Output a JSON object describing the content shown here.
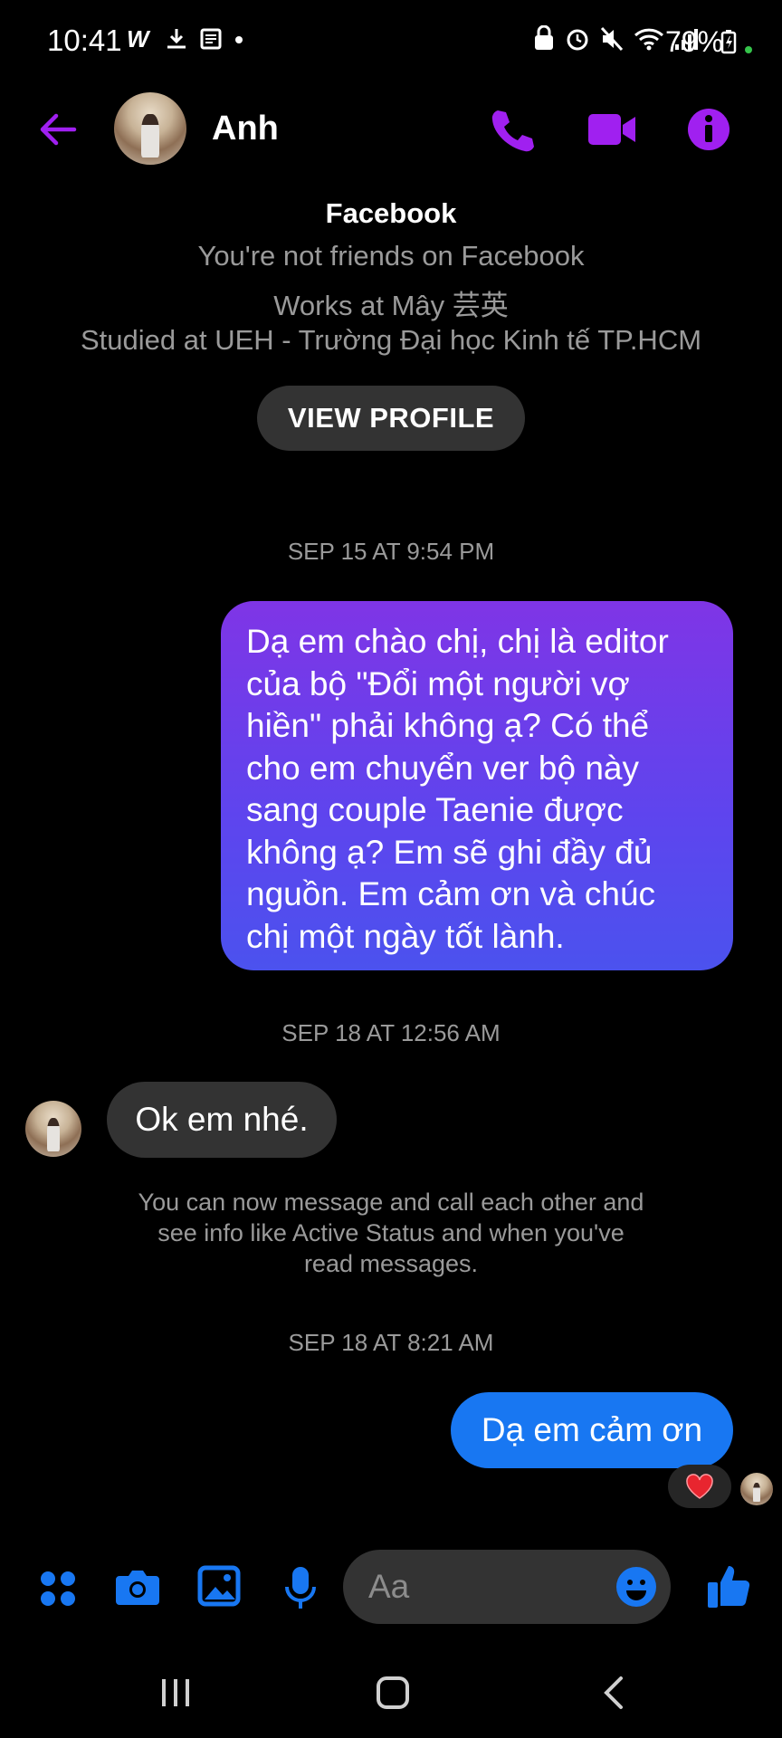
{
  "status_bar": {
    "time": "10:41",
    "battery": "79%"
  },
  "header": {
    "name": "Anh",
    "accent_color": "#a020f0"
  },
  "profile_info": {
    "title": "Facebook",
    "friends_status": "You're not friends on Facebook",
    "work": "Works at Mây 芸英",
    "education": "Studied at UEH - Trường Đại học Kinh tế TP.HCM",
    "view_profile_label": "VIEW PROFILE"
  },
  "messages": {
    "ts1": "SEP 15 AT 9:54 PM",
    "msg1_lines": [
      "Dạ em chào chị, chị là editor",
      "của bộ \"Đổi một người vợ",
      "hiền\" phải không ạ? Có thể",
      "cho em chuyển ver bộ này",
      "sang couple Taenie được",
      "không ạ? Em sẽ ghi đầy đủ",
      "nguồn. Em cảm ơn và chúc",
      "chị một ngày tốt lành."
    ],
    "ts2": "SEP 18 AT 12:56 AM",
    "msg2": "Ok em nhé.",
    "system_note_lines": [
      "You can now message and call each other and",
      "see info like Active Status and when you've",
      "read messages."
    ],
    "ts3": "SEP 18 AT 8:21 AM",
    "msg3": "Dạ em cảm ơn",
    "reaction": "heart",
    "bubble_out_color": "#1877f2",
    "bubble_in_color": "#333333"
  },
  "composer": {
    "placeholder": "Aa",
    "icon_color": "#1877f2"
  }
}
